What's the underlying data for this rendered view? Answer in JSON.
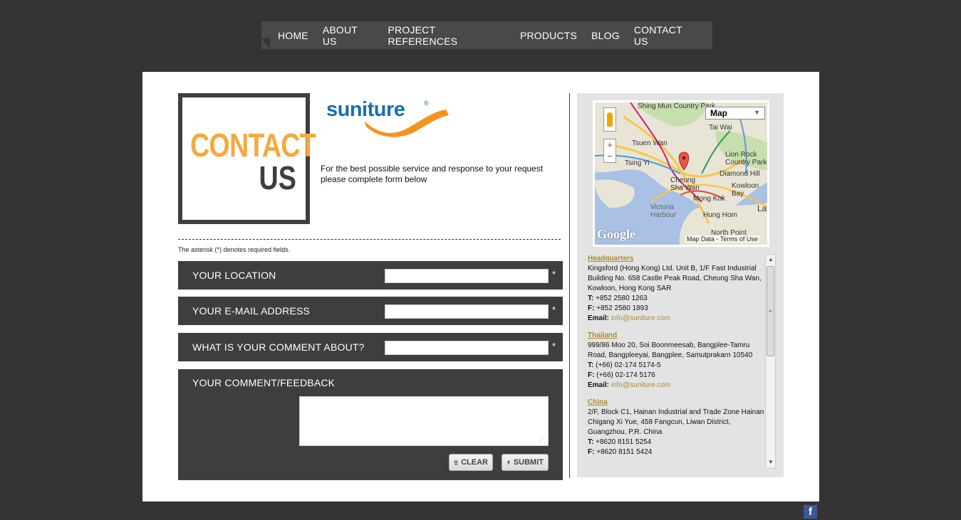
{
  "nav": {
    "items": [
      "HOME",
      "ABOUT US",
      "PROJECT REFERENCES",
      "PRODUCTS",
      "BLOG",
      "CONTACT US"
    ]
  },
  "hero": {
    "word1": "CONTACT",
    "word2": "US",
    "logo_text": "suniture",
    "logo_mark": "®",
    "intro": "For the best possible service and response to your request please complete form below"
  },
  "form": {
    "note": "The asterisk (*) denotes required fields.",
    "fields": [
      {
        "label": "YOUR LOCATION",
        "required": "*"
      },
      {
        "label": "YOUR E-MAIL ADDRESS",
        "required": "*"
      },
      {
        "label": "WHAT IS YOUR COMMENT ABOUT?",
        "required": "*"
      }
    ],
    "feedback_label": "YOUR COMMENT/FEEDBACK",
    "clear_label": "CLEAR",
    "submit_label": "SUBMIT"
  },
  "map": {
    "type_label": "Map",
    "places": [
      "Shing Mun Country Park",
      "Tai Wai",
      "Tsuen Wan",
      "Lion Rock Country Park",
      "Tsing Yi",
      "Diamond Hill",
      "Cheung Sha Wan",
      "Kowloon Bay",
      "Mong Kok",
      "Victoria Harbour",
      "Hung Hom",
      "La",
      "North Point"
    ],
    "google": "Google",
    "terms": "Map Data - Terms of Use"
  },
  "addresses": [
    {
      "heading": "Headquarters",
      "lines": [
        "Kingsford (Hong Kong) Ltd. Unit B, 1/F Fast Industrial Building No. 658 Castle Peak Road, Cheung Sha Wan, Kowloon, Hong Kong SAR"
      ],
      "tel": "+852 2580 1263",
      "fax": "+852 2580 1893",
      "email": "info@suniture.com"
    },
    {
      "heading": "Thailand",
      "lines": [
        "999/86 Moo 20, Soi Boonmeesab, Bangplee-Tamru Road, Bangpleeyai, Bangplee, Samutprakarn 10540"
      ],
      "tel": "(+66) 02-174 5174-5",
      "fax": "(+66) 02-174 5176",
      "email": "info@suniture.com"
    },
    {
      "heading": "China",
      "lines": [
        "2/F, Block C1, Hainan Industrial and Trade Zone Hainan Chigang Xi Yue, 458 Fangcun, Liwan District, Guangzhou, P.R. China"
      ],
      "tel": "+8620 8151 5254",
      "fax": "+8620 8151 5424"
    }
  ],
  "labels": {
    "tel": "T:",
    "fax": "F:",
    "email": "Email:"
  },
  "footer": {
    "facebook": "f"
  },
  "colors": {
    "accent": "#f6a93c",
    "dark": "#3f3e3f",
    "brand_blue": "#1a6db5",
    "link_gold": "#b08a2e"
  }
}
